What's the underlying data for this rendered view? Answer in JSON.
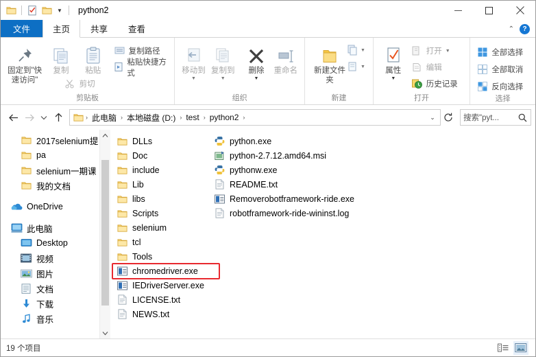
{
  "window": {
    "title": "python2",
    "quick_access": [
      "folder-icon",
      "properties-icon",
      "new-folder-icon"
    ],
    "controls": {
      "minimize": "minimize-icon",
      "maximize": "maximize-icon",
      "close": "close-icon"
    }
  },
  "tabs": [
    {
      "label": "文件",
      "name": "tab-file"
    },
    {
      "label": "主页",
      "name": "tab-home"
    },
    {
      "label": "共享",
      "name": "tab-share"
    },
    {
      "label": "查看",
      "name": "tab-view"
    }
  ],
  "ribbon": {
    "help_label": "?",
    "groups": [
      {
        "label": "剪贴板",
        "big": [
          {
            "label": "固定到\"快速访问\"",
            "icon": "pin-icon",
            "dim": false
          },
          {
            "label": "复制",
            "icon": "copy-icon",
            "dim": true
          },
          {
            "label": "粘贴",
            "icon": "paste-icon",
            "dim": true
          }
        ],
        "small": [
          {
            "label": "剪切",
            "icon": "scissors-icon",
            "dim": true
          },
          {
            "label": "复制路径",
            "icon": "copy-path-icon",
            "dim": false
          },
          {
            "label": "粘贴快捷方式",
            "icon": "paste-shortcut-icon",
            "dim": false
          }
        ]
      },
      {
        "label": "组织",
        "big": [
          {
            "label": "移动到",
            "icon": "move-to-icon",
            "dim": true
          },
          {
            "label": "复制到",
            "icon": "copy-to-icon",
            "dim": true
          },
          {
            "label": "删除",
            "icon": "delete-x-icon",
            "dim": false
          },
          {
            "label": "重命名",
            "icon": "rename-icon",
            "dim": true
          }
        ]
      },
      {
        "label": "新建",
        "big": [
          {
            "label": "新建文件夹",
            "icon": "new-folder-icon",
            "dim": false
          }
        ],
        "stack": [
          {
            "icon": "new-item-icon"
          },
          {
            "icon": "easy-access-icon"
          }
        ]
      },
      {
        "label": "打开",
        "big": [
          {
            "label": "属性",
            "icon": "properties-icon",
            "dim": false
          }
        ],
        "small": [
          {
            "label": "打开",
            "icon": "open-icon",
            "dim": true
          },
          {
            "label": "编辑",
            "icon": "edit-icon",
            "dim": true
          },
          {
            "label": "历史记录",
            "icon": "history-icon",
            "dim": false
          }
        ]
      },
      {
        "label": "选择",
        "small": [
          {
            "label": "全部选择",
            "icon": "select-all-icon",
            "dim": false
          },
          {
            "label": "全部取消",
            "icon": "select-none-icon",
            "dim": false
          },
          {
            "label": "反向选择",
            "icon": "invert-selection-icon",
            "dim": false
          }
        ]
      }
    ]
  },
  "address": {
    "back": "back-arrow-icon",
    "forward": "forward-arrow-icon",
    "recent": "recent-locations-icon",
    "up": "up-arrow-icon",
    "breadcrumbs": [
      "此电脑",
      "本地磁盘 (D:)",
      "test",
      "python2"
    ],
    "separator": "›",
    "refresh": "refresh-icon",
    "search_value": "搜索\"pyt...",
    "search_placeholder": "搜索\"python2\""
  },
  "sidebar": {
    "groups": [
      {
        "items": [
          {
            "label": "2017selenium提",
            "icon": "folder-icon",
            "indent": 1
          },
          {
            "label": "pa",
            "icon": "folder-icon",
            "indent": 1
          },
          {
            "label": "selenium一期课",
            "icon": "folder-icon",
            "indent": 1
          },
          {
            "label": "我的文档",
            "icon": "folder-icon",
            "indent": 1
          }
        ]
      },
      {
        "items": [
          {
            "label": "OneDrive",
            "icon": "onedrive-cloud-icon",
            "indent": 0
          }
        ]
      },
      {
        "items": [
          {
            "label": "此电脑",
            "icon": "this-pc-icon",
            "indent": 0
          },
          {
            "label": "Desktop",
            "icon": "desktop-icon",
            "indent": 1
          },
          {
            "label": "视频",
            "icon": "videos-icon",
            "indent": 1
          },
          {
            "label": "图片",
            "icon": "pictures-icon",
            "indent": 1
          },
          {
            "label": "文档",
            "icon": "documents-icon",
            "indent": 1
          },
          {
            "label": "下载",
            "icon": "downloads-icon",
            "indent": 1
          },
          {
            "label": "音乐",
            "icon": "music-icon",
            "indent": 1
          }
        ]
      }
    ],
    "scroll_up": "chevron-up-icon",
    "scroll_down": "chevron-down-icon"
  },
  "files": {
    "column1": [
      {
        "name": "DLLs",
        "icon": "folder-icon"
      },
      {
        "name": "Doc",
        "icon": "folder-icon"
      },
      {
        "name": "include",
        "icon": "folder-icon"
      },
      {
        "name": "Lib",
        "icon": "folder-icon"
      },
      {
        "name": "libs",
        "icon": "folder-icon"
      },
      {
        "name": "Scripts",
        "icon": "folder-icon"
      },
      {
        "name": "selenium",
        "icon": "folder-icon"
      },
      {
        "name": "tcl",
        "icon": "folder-icon"
      },
      {
        "name": "Tools",
        "icon": "folder-icon"
      },
      {
        "name": "chromedriver.exe",
        "icon": "exe-icon",
        "highlighted": true
      },
      {
        "name": "IEDriverServer.exe",
        "icon": "exe-icon"
      },
      {
        "name": "LICENSE.txt",
        "icon": "txt-icon"
      },
      {
        "name": "NEWS.txt",
        "icon": "txt-icon"
      }
    ],
    "column2": [
      {
        "name": "python.exe",
        "icon": "python-exe-icon"
      },
      {
        "name": "python-2.7.12.amd64.msi",
        "icon": "msi-icon"
      },
      {
        "name": "pythonw.exe",
        "icon": "python-exe-icon"
      },
      {
        "name": "README.txt",
        "icon": "txt-icon"
      },
      {
        "name": "Removerobotframework-ride.exe",
        "icon": "exe-icon"
      },
      {
        "name": "robotframework-ride-wininst.log",
        "icon": "log-icon"
      }
    ]
  },
  "status": {
    "item_count": "19 个项目",
    "views": [
      {
        "name": "details-view-button",
        "icon": "details-view-icon",
        "selected": false
      },
      {
        "name": "large-icons-view-button",
        "icon": "large-icons-view-icon",
        "selected": true
      }
    ]
  },
  "colors": {
    "accent": "#0d6fc4",
    "highlight": "#e8292f",
    "folder": "#f7cf6b"
  }
}
